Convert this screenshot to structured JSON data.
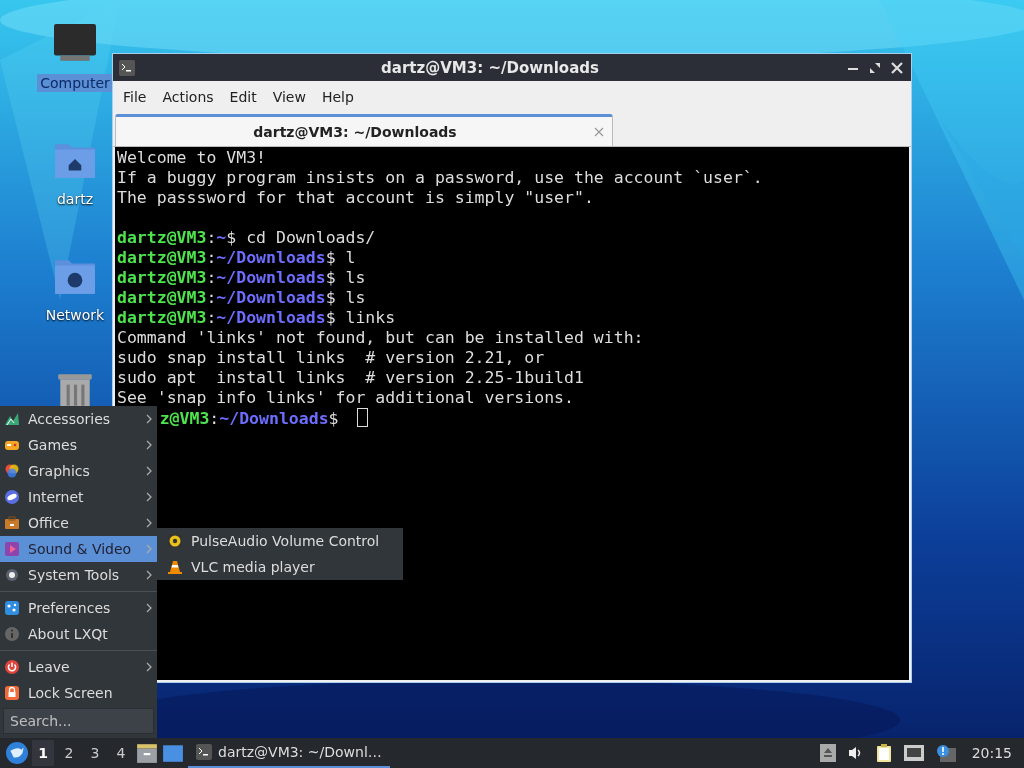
{
  "desktop_icons": [
    {
      "label": "Computer",
      "kind": "computer",
      "selected": true
    },
    {
      "label": "dartz",
      "kind": "home",
      "selected": false
    },
    {
      "label": "Network",
      "kind": "network",
      "selected": false
    },
    {
      "kind": "trash",
      "selected": false
    }
  ],
  "window": {
    "title": "dartz@VM3: ~/Downloads",
    "menu": [
      "File",
      "Actions",
      "Edit",
      "View",
      "Help"
    ],
    "tab": {
      "label": "dartz@VM3: ~/Downloads"
    },
    "lines": [
      {
        "kind": "text",
        "text": "Welcome to VM3!"
      },
      {
        "kind": "text",
        "text": "If a buggy program insists on a password, use the account `user`."
      },
      {
        "kind": "text",
        "text": "The passsword for that account is simply \"user\"."
      },
      {
        "kind": "blank"
      },
      {
        "kind": "prompt",
        "user": "dartz@VM3",
        "sep": ":",
        "path": "~",
        "mark": "$",
        "command": "cd Downloads/"
      },
      {
        "kind": "prompt",
        "user": "dartz@VM3",
        "sep": ":",
        "path": "~/Downloads",
        "mark": "$",
        "command": "l"
      },
      {
        "kind": "prompt",
        "user": "dartz@VM3",
        "sep": ":",
        "path": "~/Downloads",
        "mark": "$",
        "command": "ls"
      },
      {
        "kind": "prompt",
        "user": "dartz@VM3",
        "sep": ":",
        "path": "~/Downloads",
        "mark": "$",
        "command": "ls"
      },
      {
        "kind": "prompt",
        "user": "dartz@VM3",
        "sep": ":",
        "path": "~/Downloads",
        "mark": "$",
        "command": "links"
      },
      {
        "kind": "text",
        "text": "Command 'links' not found, but can be installed with:"
      },
      {
        "kind": "text",
        "text": "sudo snap install links  # version 2.21, or"
      },
      {
        "kind": "text",
        "text": "sudo apt  install links  # version 2.25-1build1"
      },
      {
        "kind": "text",
        "text": "See 'snap info links' for additional versions."
      },
      {
        "kind": "prompt_covered",
        "user": "z@VM3",
        "sep": ":",
        "path": "~/Downloads",
        "mark": "$",
        "cursor": true
      }
    ]
  },
  "start_menu": {
    "groups": [
      [
        {
          "label": "Accessories",
          "kind": "accessories",
          "submenu": true,
          "selected": false
        },
        {
          "label": "Games",
          "kind": "games",
          "submenu": true,
          "selected": false
        },
        {
          "label": "Graphics",
          "kind": "graphics",
          "submenu": true,
          "selected": false
        },
        {
          "label": "Internet",
          "kind": "internet",
          "submenu": true,
          "selected": false
        },
        {
          "label": "Office",
          "kind": "office",
          "submenu": true,
          "selected": false
        },
        {
          "label": "Sound & Video",
          "kind": "media",
          "submenu": true,
          "selected": true
        },
        {
          "label": "System Tools",
          "kind": "system",
          "submenu": true,
          "selected": false
        }
      ],
      [
        {
          "label": "Preferences",
          "kind": "preferences",
          "submenu": true,
          "selected": false
        },
        {
          "label": "About LXQt",
          "kind": "about",
          "submenu": false,
          "selected": false
        }
      ],
      [
        {
          "label": "Leave",
          "kind": "leave",
          "submenu": true,
          "selected": false
        },
        {
          "label": "Lock Screen",
          "kind": "lock",
          "submenu": false,
          "selected": false
        }
      ]
    ],
    "search": {
      "placeholder": "Search..."
    }
  },
  "submenu": [
    {
      "label": "PulseAudio Volume Control",
      "kind": "pulseaudio"
    },
    {
      "label": "VLC media player",
      "kind": "vlc"
    }
  ],
  "taskbar": {
    "desktops": [
      {
        "label": "1",
        "selected": true
      },
      {
        "label": "2",
        "selected": false
      },
      {
        "label": "3",
        "selected": false
      },
      {
        "label": "4",
        "selected": false
      }
    ],
    "task": {
      "label": "dartz@VM3: ~/Downl…",
      "selected": true
    },
    "clock": "20:15"
  }
}
